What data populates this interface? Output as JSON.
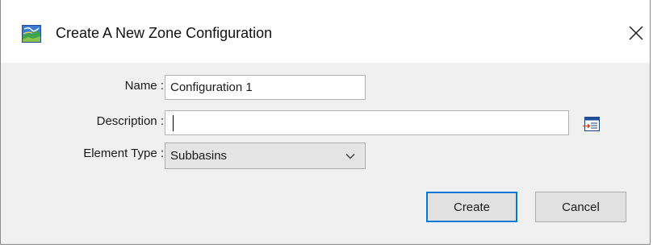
{
  "window": {
    "title": "Create A New Zone Configuration",
    "app_icon": "watershed-map-icon",
    "close_icon": "close-icon"
  },
  "form": {
    "name": {
      "label": "Name :",
      "value": "Configuration 1"
    },
    "description": {
      "label": "Description :",
      "value": "",
      "editor_icon": "edit-description-icon"
    },
    "element_type": {
      "label": "Element Type :",
      "selected": "Subbasins",
      "dropdown_icon": "chevron-down-icon"
    }
  },
  "buttons": {
    "create_label": "Create",
    "cancel_label": "Cancel"
  },
  "colors": {
    "dialog_background": "#f0f0f0",
    "titlebar_background": "#ffffff",
    "focus_border": "#0078d7"
  }
}
